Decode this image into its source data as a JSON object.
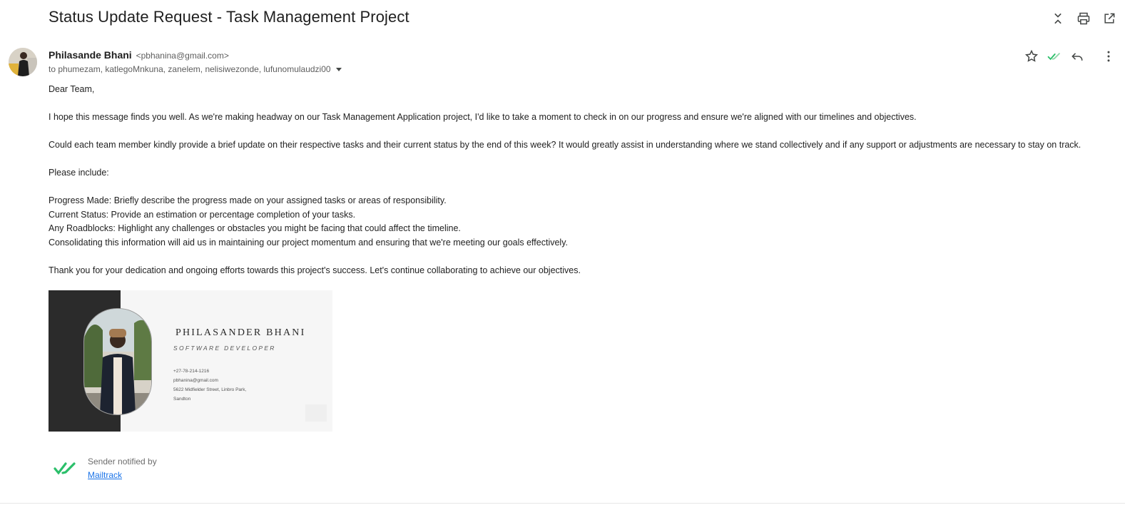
{
  "subject": "Status Update Request - Task Management Project",
  "top_actions": [
    {
      "icon": "collapse-icon"
    },
    {
      "icon": "print-icon"
    },
    {
      "icon": "open-in-new-window-icon"
    }
  ],
  "sender": {
    "name": "Philasande Bhani",
    "email": "<pbhanina@gmail.com>",
    "recipients": "to phumezam, katlegoMnkuna, zanelem, nelisiwezonde, lufunomulaudzi00"
  },
  "message_actions": [
    {
      "icon": "star-icon"
    },
    {
      "icon": "mailtrack-check-icon"
    },
    {
      "icon": "reply-icon"
    },
    {
      "icon": "more-vert-icon"
    }
  ],
  "body": {
    "greeting": "Dear Team,",
    "p1": "I hope this message finds you well. As we're making headway on our Task Management Application project, I'd like to take a moment to check in on our progress and ensure we're aligned with our timelines and objectives.",
    "p2": "Could each team member kindly provide a brief update on their respective tasks and their current status by the end of this week? It would greatly assist in understanding where we stand collectively and if any support or adjustments are necessary to stay on track.",
    "p3": "Please include:",
    "items": [
      "Progress Made: Briefly describe the progress made on your assigned tasks or areas of responsibility.",
      "Current Status: Provide an estimation or percentage completion of your tasks.",
      "Any Roadblocks: Highlight any challenges or obstacles you might be facing that could affect the timeline.",
      "Consolidating this information will aid us in maintaining our project momentum and ensuring that we're meeting our goals effectively."
    ],
    "closing": "Thank you for your dedication and ongoing efforts towards this project's success. Let's continue collaborating to achieve our objectives."
  },
  "signature": {
    "name": "PHILASANDER BHANI",
    "role": "SOFTWARE DEVELOPER",
    "phone": "+27-78-214-1216",
    "email": "pbhanina@gmail.com",
    "address_line1": "5622 Midfielder Street, Linbro Park,",
    "address_line2": "Sandton"
  },
  "mailtrack": {
    "text": "Sender notified by",
    "link": "Mailtrack",
    "accent": "#2bbf6a"
  }
}
